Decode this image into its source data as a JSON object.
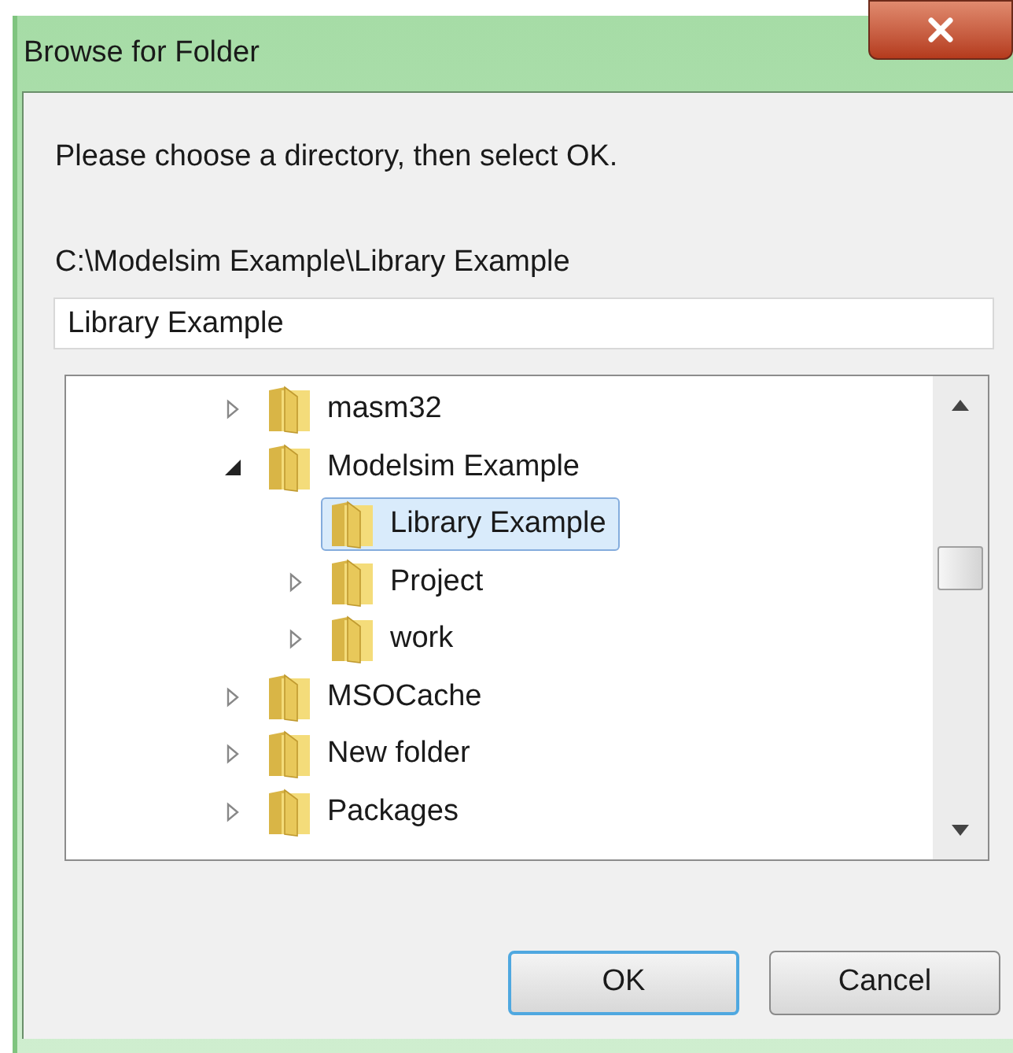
{
  "window": {
    "title": "Browse for Folder"
  },
  "instruction": "Please choose a directory, then select OK.",
  "path": "C:\\Modelsim Example\\Library Example",
  "folder_field": {
    "value": "Library Example"
  },
  "tree": [
    {
      "label": "masm32",
      "has_children": true,
      "expanded": false,
      "selected": false
    },
    {
      "label": "Modelsim Example",
      "has_children": true,
      "expanded": true,
      "selected": false,
      "children": [
        {
          "label": "Library Example",
          "has_children": false,
          "selected": true
        },
        {
          "label": "Project",
          "has_children": true,
          "expanded": false,
          "selected": false
        },
        {
          "label": "work",
          "has_children": true,
          "expanded": false,
          "selected": false
        }
      ]
    },
    {
      "label": "MSOCache",
      "has_children": true,
      "expanded": false,
      "selected": false
    },
    {
      "label": "New folder",
      "has_children": true,
      "expanded": false,
      "selected": false
    },
    {
      "label": "Packages",
      "has_children": true,
      "expanded": false,
      "selected": false
    }
  ],
  "buttons": [
    {
      "label": "OK",
      "default": true
    },
    {
      "label": "Cancel",
      "default": false
    }
  ]
}
